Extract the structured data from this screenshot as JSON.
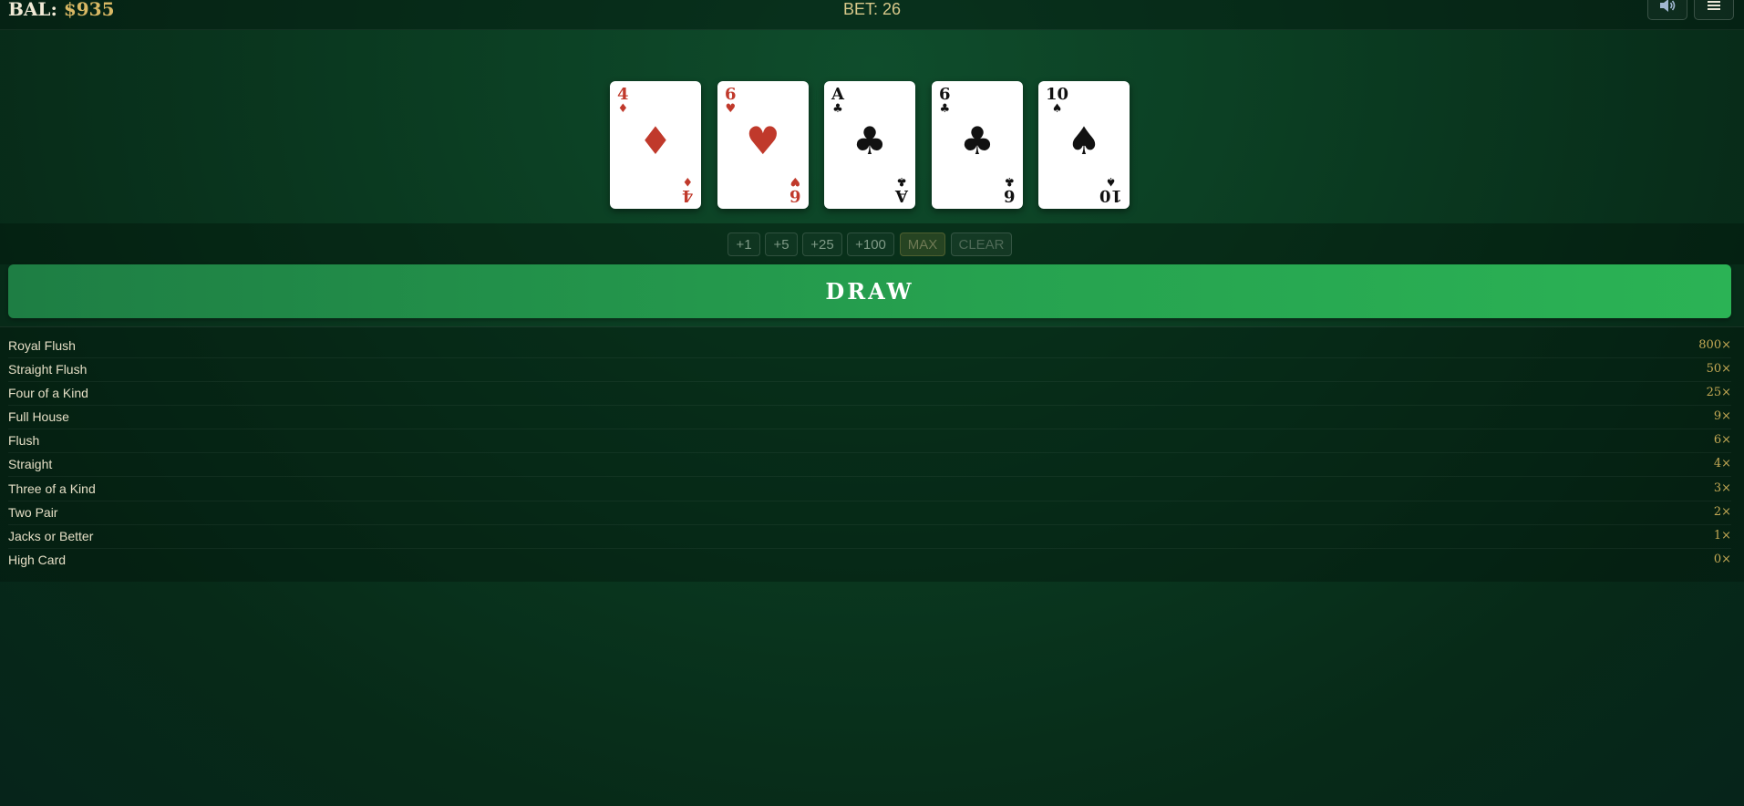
{
  "header": {
    "balance_label": "BAL:",
    "balance_amount": "$935",
    "bet_text": "BET: 26",
    "sound_icon": "speaker-icon",
    "menu_icon": "hamburger-menu-icon"
  },
  "hand": [
    {
      "rank": "4",
      "suit": "♦",
      "suit_name": "diamonds",
      "color": "#c0392b"
    },
    {
      "rank": "6",
      "suit": "♥",
      "suit_name": "hearts",
      "color": "#c0392b"
    },
    {
      "rank": "A",
      "suit": "♣",
      "suit_name": "clubs",
      "color": "#111111"
    },
    {
      "rank": "6",
      "suit": "♣",
      "suit_name": "clubs",
      "color": "#111111"
    },
    {
      "rank": "10",
      "suit": "♠",
      "suit_name": "spades",
      "color": "#111111"
    }
  ],
  "bet_buttons": [
    "+1",
    "+5",
    "+25",
    "+100",
    "MAX",
    "CLEAR"
  ],
  "draw_button": "DRAW",
  "paytable": [
    {
      "hand": "Royal Flush",
      "multiplier": "800×"
    },
    {
      "hand": "Straight Flush",
      "multiplier": "50×"
    },
    {
      "hand": "Four of a Kind",
      "multiplier": "25×"
    },
    {
      "hand": "Full House",
      "multiplier": "9×"
    },
    {
      "hand": "Flush",
      "multiplier": "6×"
    },
    {
      "hand": "Straight",
      "multiplier": "4×"
    },
    {
      "hand": "Three of a Kind",
      "multiplier": "3×"
    },
    {
      "hand": "Two Pair",
      "multiplier": "2×"
    },
    {
      "hand": "Jacks or Better",
      "multiplier": "1×"
    },
    {
      "hand": "High Card",
      "multiplier": "0×"
    }
  ],
  "colors": {
    "felt": "#0b3d22",
    "gold": "#d8b864",
    "draw_green": "#26a14f",
    "red_suit": "#c0392b",
    "black_suit": "#111111"
  }
}
